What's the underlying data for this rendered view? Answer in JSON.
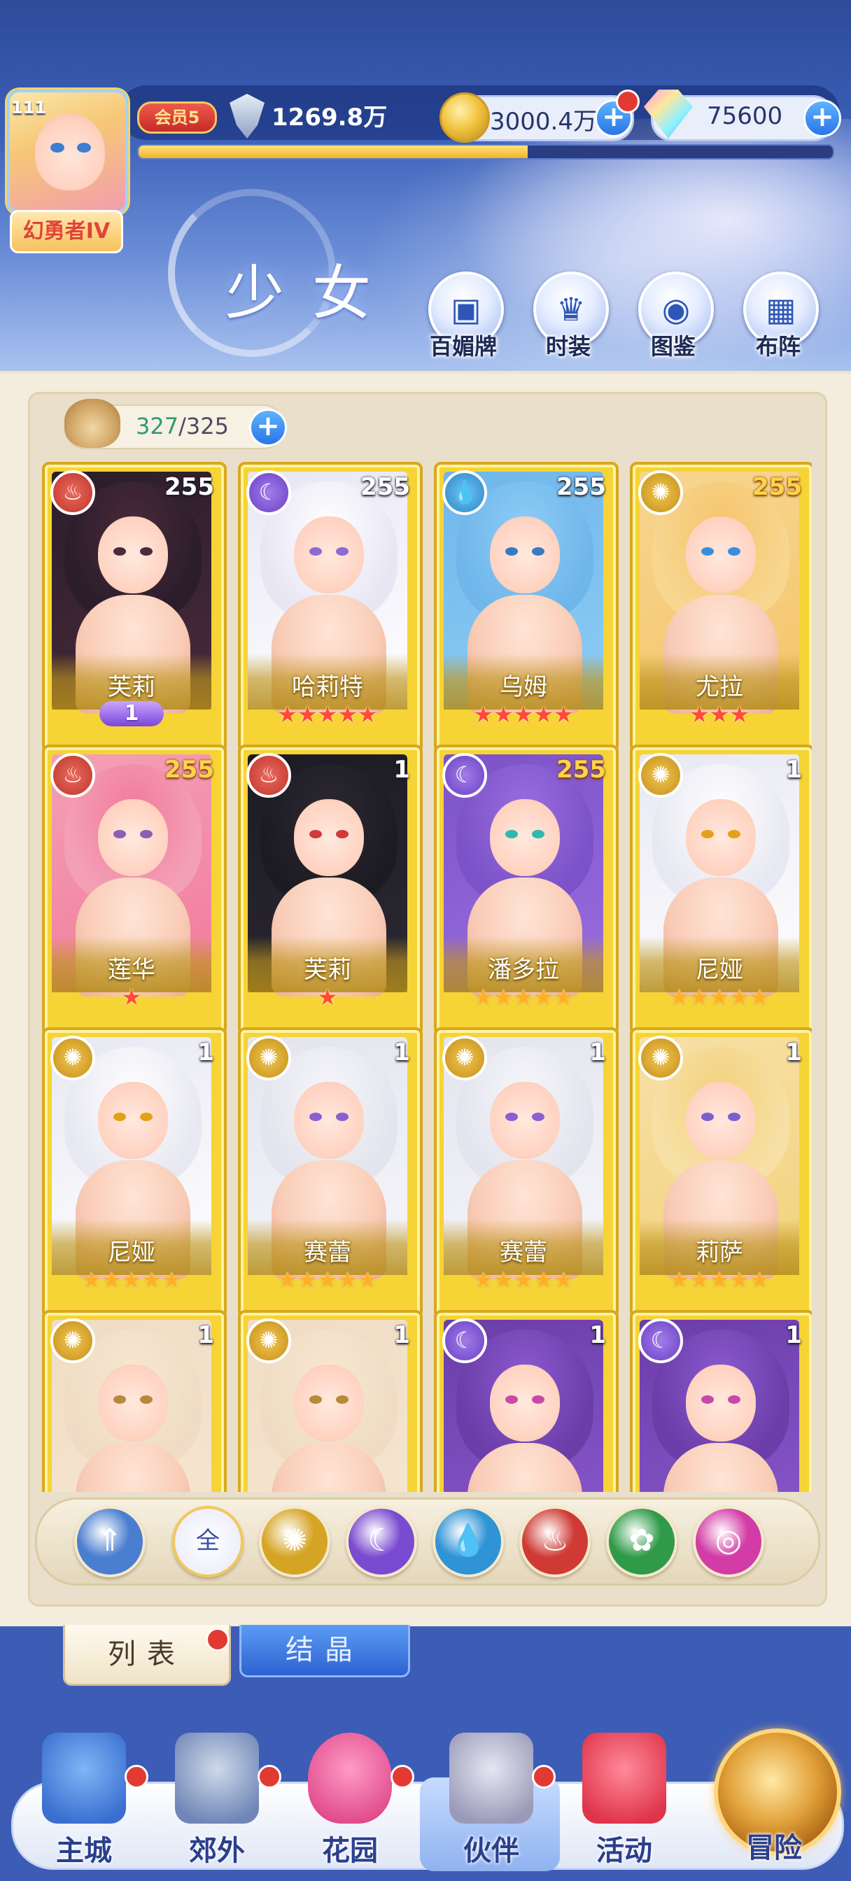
{
  "header": {
    "player_level": "111",
    "player_title": "幻勇者IV",
    "vip_label": "会员5",
    "power": "1269.8万",
    "xp_fraction": 0.56,
    "gold": "3000.4万",
    "gems": "75600",
    "page_title": "少女",
    "buttons": [
      {
        "label": "百媚牌",
        "icon": "cards-icon"
      },
      {
        "label": "时装",
        "icon": "outfit-icon"
      },
      {
        "label": "图鉴",
        "icon": "codex-icon"
      },
      {
        "label": "布阵",
        "icon": "formation-icon"
      }
    ]
  },
  "roster": {
    "count_current": "327",
    "count_separator": "/325"
  },
  "cards": [
    {
      "name": "芙莉",
      "level": "255",
      "element": "fire",
      "stars": 0,
      "star_color": "red",
      "wings": "1",
      "art": [
        "#2b1d2a",
        "#4a2a3b",
        "#c84b5b",
        "#4a2a3b"
      ]
    },
    {
      "name": "哈莉特",
      "level": "255",
      "element": "moon",
      "stars": 5,
      "star_color": "red",
      "art": [
        "#e9e6f4",
        "#ffffff",
        "#c5b3e9",
        "#8e6ad1"
      ]
    },
    {
      "name": "乌姆",
      "level": "255",
      "element": "water",
      "stars": 5,
      "star_color": "red",
      "art": [
        "#6fb6ea",
        "#8dcdf6",
        "#f2f4fb",
        "#3a7ac2"
      ]
    },
    {
      "name": "尤拉",
      "level": "255",
      "element": "sun",
      "level_gold": true,
      "stars": 3,
      "star_color": "red",
      "art": [
        "#f7d690",
        "#f5c46a",
        "#ffffff",
        "#3b8ddc"
      ]
    },
    {
      "name": "莲华",
      "level": "255",
      "element": "fire",
      "level_gold": true,
      "stars": 1,
      "star_color": "red",
      "art": [
        "#f3a0b6",
        "#f27a9a",
        "#ffffff",
        "#8a5fb4"
      ]
    },
    {
      "name": "芙莉",
      "level": "1",
      "element": "fire",
      "stars": 1,
      "star_color": "red",
      "art": [
        "#1c1b22",
        "#2c2833",
        "#3a3140",
        "#d13a3a"
      ]
    },
    {
      "name": "潘多拉",
      "level": "255",
      "element": "moon",
      "level_gold": true,
      "stars": 5,
      "star_color": "gold",
      "art": [
        "#7c52c8",
        "#9a6ee0",
        "#5a3aa0",
        "#2fb8b0"
      ]
    },
    {
      "name": "尼娅",
      "level": "1",
      "element": "sun",
      "stars": 5,
      "star_color": "gold",
      "art": [
        "#e8e8f2",
        "#ffffff",
        "#f6f6fb",
        "#e2a11a"
      ]
    },
    {
      "name": "尼娅",
      "level": "1",
      "element": "sun",
      "stars": 5,
      "star_color": "gold",
      "art": [
        "#e8e8f2",
        "#ffffff",
        "#f6f6fb",
        "#e2a11a"
      ]
    },
    {
      "name": "赛蕾",
      "level": "1",
      "element": "sun",
      "stars": 5,
      "star_color": "gold",
      "art": [
        "#e4e4ee",
        "#f6f6fb",
        "#2a2a33",
        "#8a5fcf"
      ]
    },
    {
      "name": "赛蕾",
      "level": "1",
      "element": "sun",
      "stars": 5,
      "star_color": "gold",
      "art": [
        "#e4e4ee",
        "#f6f6fb",
        "#2a2a33",
        "#8a5fcf"
      ]
    },
    {
      "name": "莉萨",
      "level": "1",
      "element": "sun",
      "stars": 5,
      "star_color": "gold",
      "art": [
        "#f7e0a6",
        "#f3d27c",
        "#2a2a33",
        "#7a5fcf"
      ]
    },
    {
      "name": "",
      "level": "1",
      "element": "sun",
      "stars": 0,
      "star_color": "gold",
      "art": [
        "#f0dcc4",
        "#f6e7d2",
        "#ffffff",
        "#b58a3a"
      ]
    },
    {
      "name": "",
      "level": "1",
      "element": "sun",
      "stars": 0,
      "star_color": "gold",
      "art": [
        "#f0dcc4",
        "#f6e7d2",
        "#ffffff",
        "#b58a3a"
      ]
    },
    {
      "name": "",
      "level": "1",
      "element": "moon",
      "stars": 0,
      "star_color": "gold",
      "art": [
        "#6b3da8",
        "#8b5ad0",
        "#ffffff",
        "#c74aa8"
      ]
    },
    {
      "name": "",
      "level": "1",
      "element": "moon",
      "stars": 0,
      "star_color": "gold",
      "art": [
        "#6b3da8",
        "#8b5ad0",
        "#ffffff",
        "#c74aa8"
      ]
    }
  ],
  "filters": [
    {
      "id": "wind",
      "label": "",
      "icon": "wind-arrow-icon",
      "color": "#4a7ed0"
    },
    {
      "id": "all",
      "label": "全",
      "icon": "all-icon",
      "color": "#ffffff"
    },
    {
      "id": "sun",
      "label": "",
      "icon": "sun-icon",
      "color": "#d6a425"
    },
    {
      "id": "moon",
      "label": "",
      "icon": "moon-icon",
      "color": "#7a4ad0"
    },
    {
      "id": "water",
      "label": "",
      "icon": "water-drop-icon",
      "color": "#2f93d6"
    },
    {
      "id": "fire",
      "label": "",
      "icon": "fire-icon",
      "color": "#cf3b34"
    },
    {
      "id": "nature",
      "label": "",
      "icon": "tornado-icon",
      "color": "#2f9a48"
    },
    {
      "id": "arcane",
      "label": "",
      "icon": "orb-icon",
      "color": "#d33ba6"
    }
  ],
  "tabs": {
    "list": "列表",
    "crystal": "结晶"
  },
  "nav": [
    {
      "label": "主城",
      "icon": "castle-icon"
    },
    {
      "label": "郊外",
      "icon": "portal-icon"
    },
    {
      "label": "花园",
      "icon": "heart-icon"
    },
    {
      "label": "伙伴",
      "icon": "partner-icon"
    },
    {
      "label": "活动",
      "icon": "gift-icon"
    },
    {
      "label": "冒险",
      "icon": "compass-icon"
    }
  ]
}
